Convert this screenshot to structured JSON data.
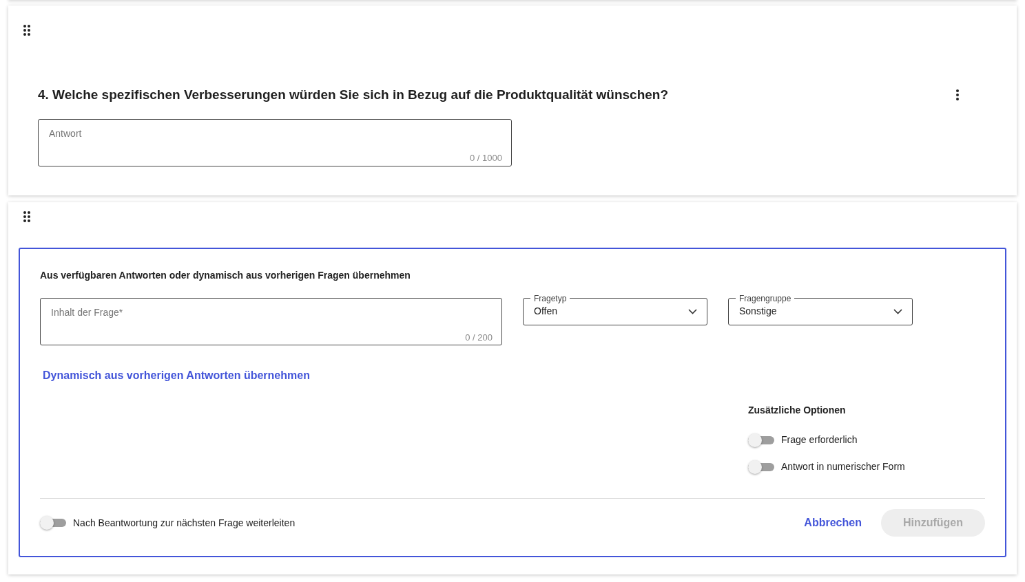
{
  "question_card": {
    "title": "4. Welche spezifischen Verbesserungen würden Sie sich in Bezug auf die Produktqualität wünschen?",
    "answer_field": {
      "placeholder": "Antwort",
      "counter": "0 / 1000"
    }
  },
  "editor": {
    "heading": "Aus verfügbaren Antworten oder dynamisch aus vorherigen Fragen übernehmen",
    "content_field": {
      "placeholder": "Inhalt der Frage*",
      "counter": "0 / 200"
    },
    "selects": [
      {
        "label": "Fragetyp",
        "value": "Offen"
      },
      {
        "label": "Fragengruppe",
        "value": "Sonstige"
      }
    ],
    "dynamic_link": "Dynamisch aus vorherigen Antworten übernehmen",
    "options": {
      "title": "Zusätzliche Optionen",
      "toggles": [
        {
          "label": "Frage erforderlich",
          "on": false
        },
        {
          "label": "Antwort in numerischer Form",
          "on": false
        }
      ]
    },
    "forward_toggle": {
      "label": "Nach Beantwortung zur nächsten Frage weiterleiten",
      "on": false
    },
    "buttons": [
      {
        "label": "Abbrechen",
        "kind": "text",
        "disabled": false
      },
      {
        "label": "Hinzufügen",
        "kind": "filled",
        "disabled": true
      }
    ]
  }
}
